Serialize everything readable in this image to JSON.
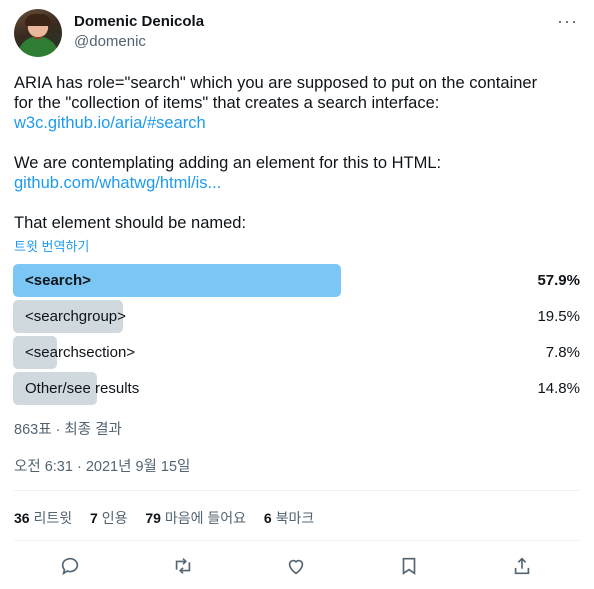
{
  "author": {
    "name": "Domenic Denicola",
    "handle": "@domenic"
  },
  "tweet": {
    "line1": "ARIA has role=\"search\" which you are supposed to put on the container",
    "line2": "for the \"collection of items\" that creates a search interface:",
    "link1": "w3c.github.io/aria/#search",
    "line3": "We are contemplating adding an element for this to HTML:",
    "link2": "github.com/whatwg/html/is...",
    "line4": "That element should be named:",
    "translate": "트윗 번역하기"
  },
  "poll": {
    "options": [
      {
        "label": "<search>",
        "percent": "57.9%",
        "fraction": 0.579
      },
      {
        "label": "<searchgroup>",
        "percent": "19.5%",
        "fraction": 0.195
      },
      {
        "label": "<searchsection>",
        "percent": "7.8%",
        "fraction": 0.078
      },
      {
        "label": "Other/see results",
        "percent": "14.8%",
        "fraction": 0.148
      }
    ],
    "summary": "863표 · 최종 결과"
  },
  "timestamp": "오전 6:31 · 2021년 9월 15일",
  "stats": {
    "retweets_count": "36",
    "retweets_label": "리트윗",
    "quotes_count": "7",
    "quotes_label": "인용",
    "likes_count": "79",
    "likes_label": "마음에 들어요",
    "bookmarks_count": "6",
    "bookmarks_label": "북마크"
  },
  "icons": {
    "more": "more-dots-icon",
    "reply": "reply-icon",
    "retweet": "retweet-icon",
    "like": "heart-icon",
    "bookmark": "bookmark-icon",
    "share": "share-icon"
  },
  "colors": {
    "link": "#1d9bf0",
    "winner_bar": "#7cc6f5",
    "bar": "#cfd9de",
    "muted": "#536471"
  }
}
